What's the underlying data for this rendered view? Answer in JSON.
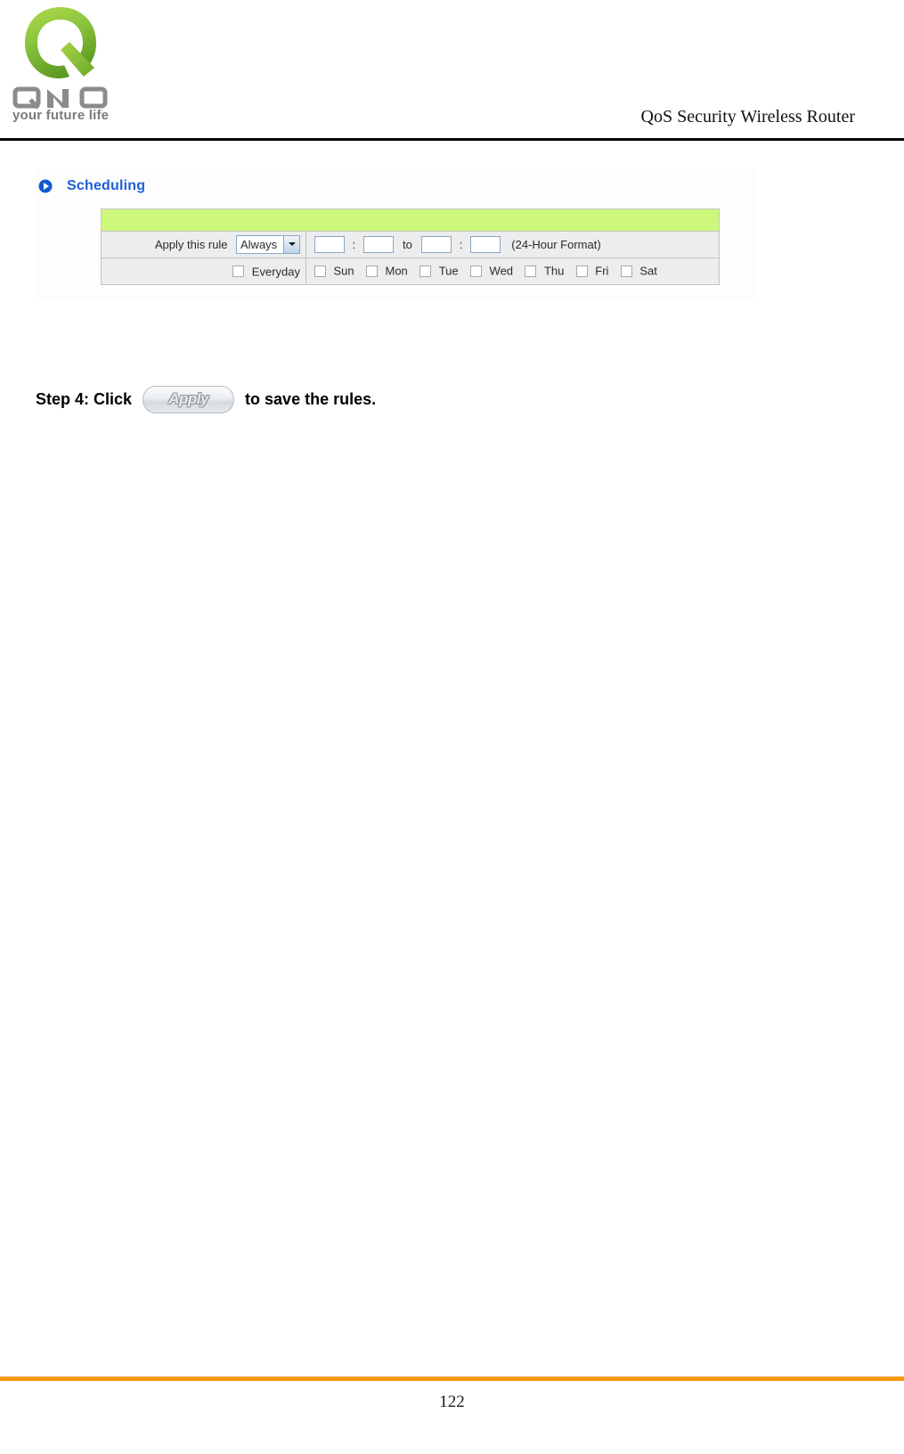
{
  "header": {
    "logo": {
      "mark_icon": "qno-q-logo-icon",
      "wordmark": "QNO",
      "tagline": "your future life"
    },
    "title": "QoS Security Wireless Router"
  },
  "scheduling": {
    "bullet_icon": "blue-play-bullet-icon",
    "title": "Scheduling",
    "rows": {
      "apply_rule": {
        "label": "Apply this rule",
        "select": {
          "value": "Always",
          "arrow_icon": "chevron-down-icon"
        },
        "time": {
          "start_hour": "",
          "start_minute": "",
          "end_hour": "",
          "end_minute": "",
          "colon": ":",
          "to": "to",
          "format_note": "(24-Hour Format)"
        }
      },
      "days": {
        "everyday_label": "Everyday",
        "everyday_checked": false,
        "items": [
          {
            "label": "Sun",
            "checked": false
          },
          {
            "label": "Mon",
            "checked": false
          },
          {
            "label": "Tue",
            "checked": false
          },
          {
            "label": "Wed",
            "checked": false
          },
          {
            "label": "Thu",
            "checked": false
          },
          {
            "label": "Fri",
            "checked": false
          },
          {
            "label": "Sat",
            "checked": false
          }
        ]
      }
    }
  },
  "step4": {
    "prefix": "Step 4: Click",
    "button_label": "Apply",
    "suffix": "to save the rules."
  },
  "footer": {
    "page_number": "122"
  },
  "colors": {
    "accent_blue": "#1e5fd6",
    "table_green": "#cdf87c",
    "table_gray": "#ededed",
    "footer_orange": "#f59a0c",
    "logo_green": "#8dc63f"
  }
}
